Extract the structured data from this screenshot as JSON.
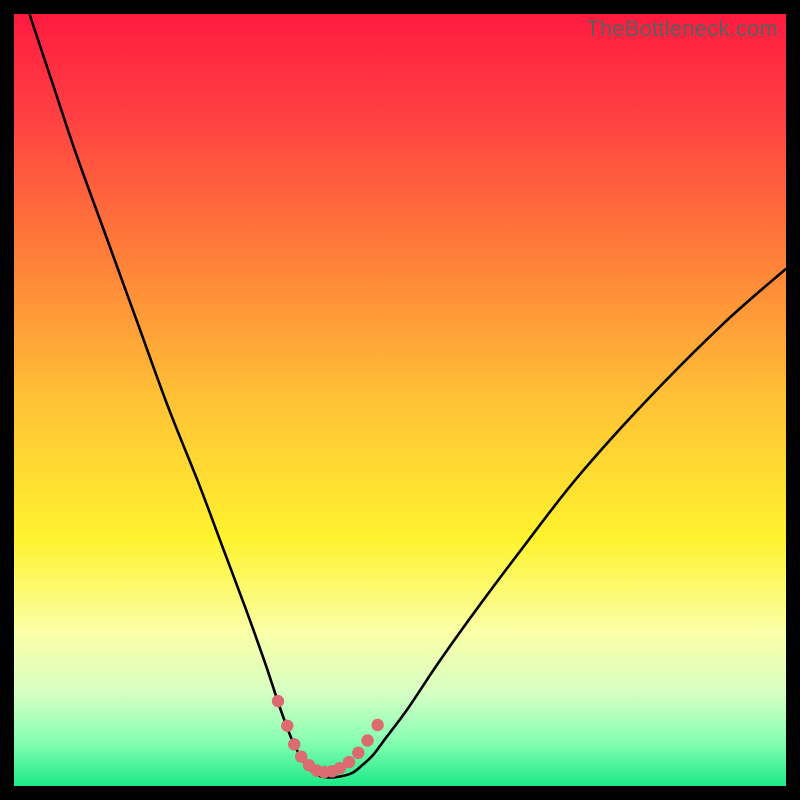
{
  "watermark": "TheBottleneck.com",
  "chart_data": {
    "type": "line",
    "title": "",
    "xlabel": "",
    "ylabel": "",
    "xlim": [
      0,
      100
    ],
    "ylim": [
      0,
      100
    ],
    "series": [
      {
        "name": "bottleneck-curve",
        "x": [
          2,
          5,
          8,
          12,
          16,
          20,
          24,
          27,
          30,
          32.5,
          34.5,
          36,
          37,
          38,
          39,
          40,
          41,
          42,
          43,
          44,
          45,
          46.5,
          48,
          51,
          55,
          60,
          66,
          73,
          82,
          92,
          100
        ],
        "y": [
          100,
          91,
          82,
          71,
          60,
          49,
          39,
          31,
          23,
          16,
          10,
          6,
          4,
          2.5,
          1.6,
          1.2,
          1.1,
          1.2,
          1.4,
          1.8,
          2.6,
          4,
          6,
          10,
          16,
          23,
          31,
          40,
          50,
          60,
          67
        ]
      }
    ],
    "markers": {
      "name": "highlight-points",
      "color": "#db6b6f",
      "x": [
        34.2,
        35.4,
        36.3,
        37.2,
        38.2,
        39.2,
        40.2,
        41.2,
        42.2,
        43.4,
        44.6,
        45.8,
        47.1
      ],
      "y": [
        11.0,
        7.8,
        5.4,
        3.8,
        2.7,
        2.0,
        1.8,
        1.9,
        2.3,
        3.1,
        4.3,
        5.9,
        7.9
      ]
    },
    "gradient_stops": [
      {
        "offset": 0.0,
        "color": "#ff1b3f"
      },
      {
        "offset": 0.12,
        "color": "#ff3c42"
      },
      {
        "offset": 0.3,
        "color": "#ff7a3a"
      },
      {
        "offset": 0.5,
        "color": "#ffc236"
      },
      {
        "offset": 0.68,
        "color": "#fff32e"
      },
      {
        "offset": 0.8,
        "color": "#fbffa6"
      },
      {
        "offset": 0.88,
        "color": "#d6ffc4"
      },
      {
        "offset": 0.94,
        "color": "#8affb3"
      },
      {
        "offset": 1.0,
        "color": "#1ce987"
      }
    ]
  }
}
